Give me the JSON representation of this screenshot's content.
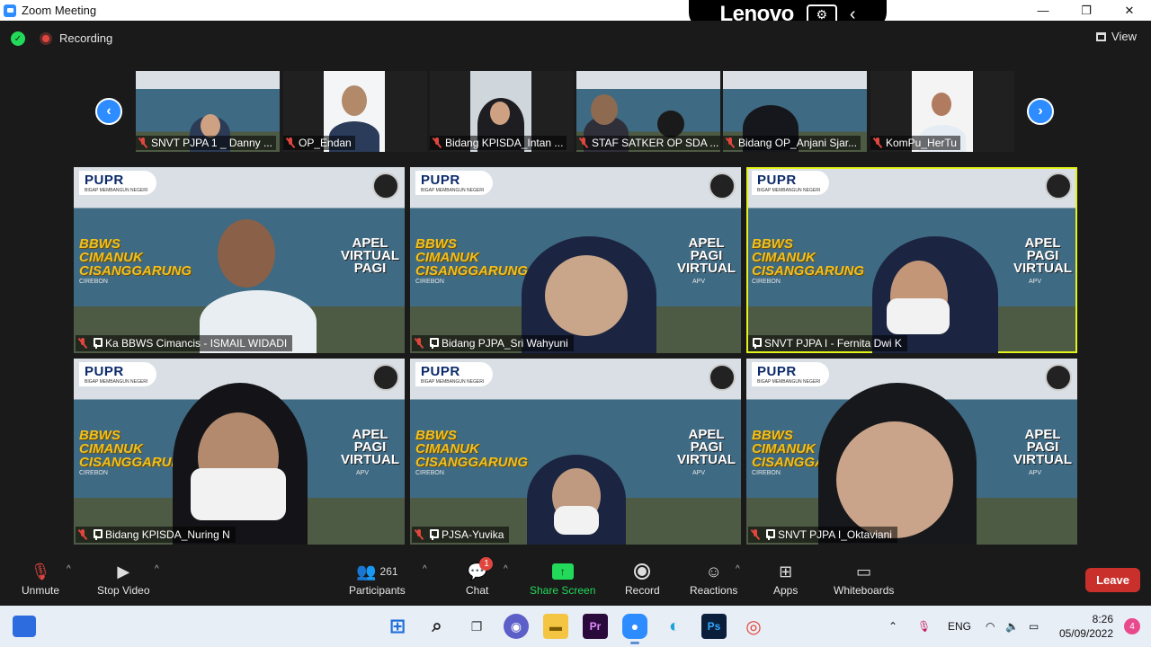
{
  "window": {
    "title": "Zoom Meeting",
    "controls": [
      "—",
      "❐",
      "✕"
    ]
  },
  "overlay": {
    "brand": "Lenovo"
  },
  "meeting_top": {
    "recording_label": "Recording",
    "view_label": "View"
  },
  "thumbnails": [
    {
      "name": "SNVT PJPA 1 _ Danny ..."
    },
    {
      "name": "OP_Endan"
    },
    {
      "name": "Bidang KPISDA_Intan ..."
    },
    {
      "name": "STAF SATKER OP SDA ..."
    },
    {
      "name": "Bidang OP_Anjani Sjar..."
    },
    {
      "name": "KomPu_HerTu"
    }
  ],
  "tiles": [
    {
      "name": "Ka BBWS Cimancis - ISMAIL WIDADI"
    },
    {
      "name": "Bidang PJPA_Sri Wahyuni"
    },
    {
      "name": "SNVT PJPA I - Fernita Dwi K"
    },
    {
      "name": "Bidang KPISDA_Nuring N"
    },
    {
      "name": "PJSA-Yuvika"
    },
    {
      "name": "SNVT PJPA I_Oktaviani"
    }
  ],
  "poster": {
    "logo": "PUPR",
    "tagline": "BIGAP MEMBANGUN NEGERI",
    "org_line1": "BBWS",
    "org_line2": "CIMANUK",
    "org_line3": "CISANGGARUNG",
    "city": "CIREBON",
    "apel_a": [
      "APEL",
      "VIRTUAL",
      "PAGI"
    ],
    "apel_b": [
      "APEL",
      "PAGI",
      "VIRTUAL"
    ],
    "apv": "APV"
  },
  "toolbar": {
    "unmute": "Unmute",
    "stop_video": "Stop Video",
    "participants_count": "261",
    "participants": "Participants",
    "chat": "Chat",
    "chat_badge": "1",
    "share_screen": "Share Screen",
    "record": "Record",
    "reactions": "Reactions",
    "apps": "Apps",
    "whiteboards": "Whiteboards",
    "leave": "Leave"
  },
  "taskbar": {
    "lang": "ENG",
    "time": "8:26",
    "date": "05/09/2022",
    "notif_count": "4"
  },
  "colors": {
    "zoom_blue": "#2d8cff",
    "share_green": "#23d959",
    "leave_red": "#c9302c",
    "active_speaker": "#e4f31b"
  }
}
